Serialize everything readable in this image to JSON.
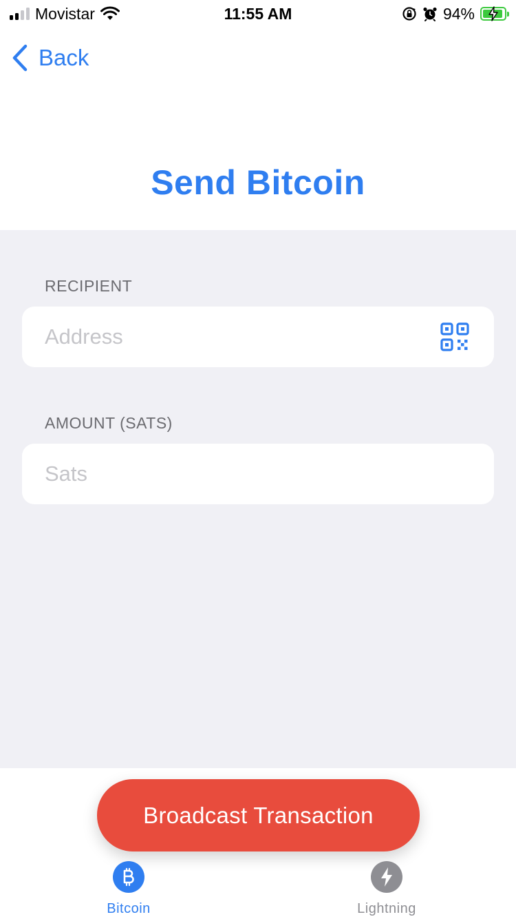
{
  "status_bar": {
    "carrier": "Movistar",
    "time": "11:55 AM",
    "battery_percent": "94%",
    "battery_level": 0.94,
    "icons": [
      "signal-icon",
      "wifi-icon",
      "orientation-lock-icon",
      "alarm-icon",
      "battery-charging-icon"
    ]
  },
  "nav": {
    "back_label": "Back"
  },
  "page": {
    "title": "Send Bitcoin"
  },
  "form": {
    "recipient": {
      "label": "RECIPIENT",
      "placeholder": "Address",
      "value": ""
    },
    "amount": {
      "label": "AMOUNT (SATS)",
      "placeholder": "Sats",
      "value": ""
    }
  },
  "actions": {
    "broadcast_label": "Broadcast Transaction"
  },
  "tabs": [
    {
      "label": "Bitcoin",
      "icon": "bitcoin-icon",
      "active": true
    },
    {
      "label": "Lightning",
      "icon": "lightning-icon",
      "active": false
    }
  ],
  "colors": {
    "accent": "#2f7ef0",
    "broadcast": "#e84c3d",
    "form_background": "#f0f0f5",
    "label_gray": "#6b6b70",
    "inactive_tab": "#8e8e93",
    "battery_green": "#3cc93e"
  }
}
